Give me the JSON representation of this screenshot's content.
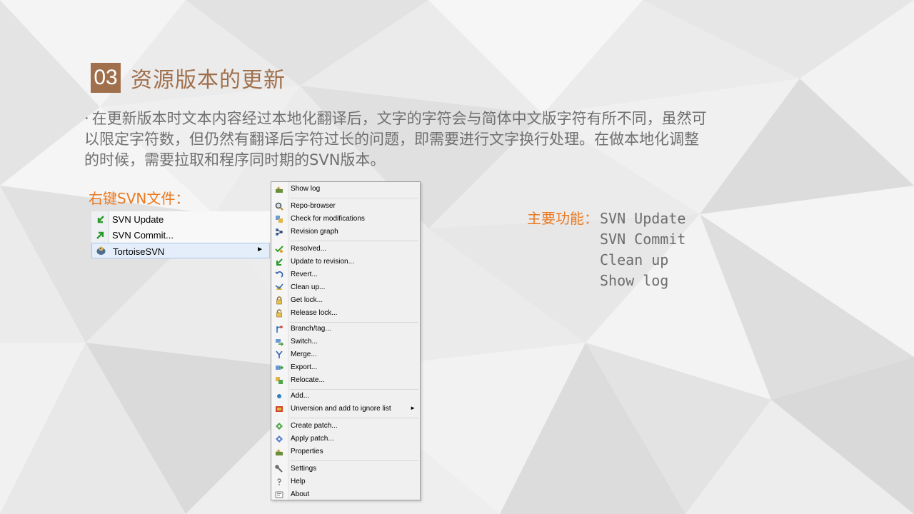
{
  "colors": {
    "accent": "#a0704c",
    "orange": "#ea7a22",
    "body_text": "#707070"
  },
  "heading": {
    "number": "03",
    "title": "资源版本的更新"
  },
  "paragraph": {
    "bullet": "·",
    "text": "在更新版本时文本内容经过本地化翻译后，文字的字符会与简体中文版字符有所不同，虽然可以限定字符数，但仍然有翻译后字符过长的问题，即需要进行文字换行处理。在做本地化调整的时候，需要拉取和程序同时期的SVN版本。"
  },
  "right_click_label": "右键SVN文件：",
  "mini_menu": {
    "items": [
      {
        "icon": "svn-update-icon",
        "label": "SVN Update"
      },
      {
        "icon": "svn-commit-icon",
        "label": "SVN Commit..."
      },
      {
        "icon": "tortoise-icon",
        "label": "TortoiseSVN",
        "submenu_arrow": "►"
      }
    ]
  },
  "context_menu": {
    "items": [
      {
        "icon": "show-log-icon",
        "label": "Show log"
      },
      {
        "icon": "repo-browser-icon",
        "label": "Repo-browser"
      },
      {
        "icon": "check-modifications-icon",
        "label": "Check for modifications"
      },
      {
        "icon": "revision-graph-icon",
        "label": "Revision graph"
      },
      {
        "icon": "resolved-icon",
        "label": "Resolved..."
      },
      {
        "icon": "update-revision-icon",
        "label": "Update to revision..."
      },
      {
        "icon": "revert-icon",
        "label": "Revert..."
      },
      {
        "icon": "clean-up-icon",
        "label": "Clean up..."
      },
      {
        "icon": "lock-icon",
        "label": "Get lock..."
      },
      {
        "icon": "unlock-icon",
        "label": "Release lock..."
      },
      {
        "icon": "branch-icon",
        "label": "Branch/tag..."
      },
      {
        "icon": "switch-icon",
        "label": "Switch..."
      },
      {
        "icon": "merge-icon",
        "label": "Merge..."
      },
      {
        "icon": "export-icon",
        "label": "Export..."
      },
      {
        "icon": "relocate-icon",
        "label": "Relocate..."
      },
      {
        "icon": "add-icon",
        "label": "Add..."
      },
      {
        "icon": "ignore-icon",
        "label": "Unversion and add to ignore list",
        "submenu_arrow": "►"
      },
      {
        "icon": "create-patch-icon",
        "label": "Create patch..."
      },
      {
        "icon": "apply-patch-icon",
        "label": "Apply patch..."
      },
      {
        "icon": "properties-icon",
        "label": "Properties"
      },
      {
        "icon": "settings-icon",
        "label": "Settings"
      },
      {
        "icon": "help-icon",
        "label": "Help"
      },
      {
        "icon": "about-icon",
        "label": "About"
      }
    ]
  },
  "features": {
    "label": "主要功能：",
    "items": [
      "SVN Update",
      "SVN Commit",
      "Clean up",
      "Show log"
    ]
  }
}
